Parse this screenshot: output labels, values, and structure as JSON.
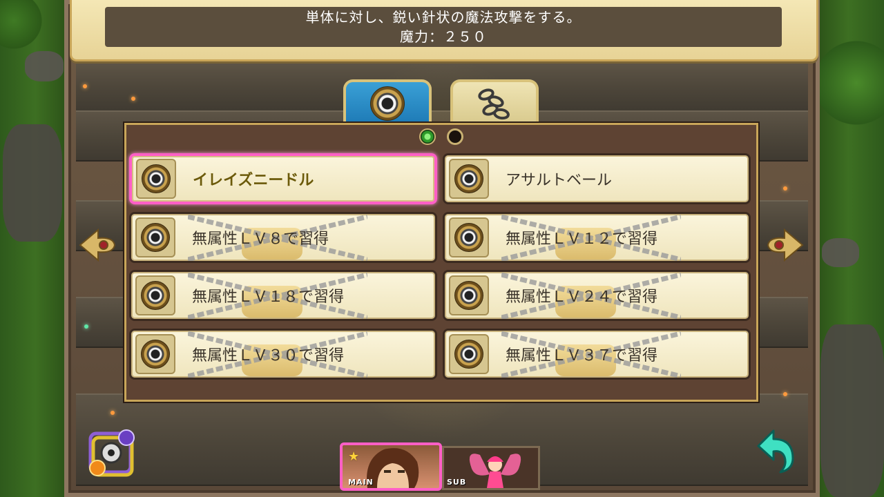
{
  "description": {
    "line1": "単体に対し、鋭い針状の魔法攻撃をする。",
    "line2": "魔力：２５０"
  },
  "tabs": [
    {
      "id": "magic",
      "icon": "eye-medal-icon",
      "selected": true
    },
    {
      "id": "chain",
      "icon": "chain-icon",
      "selected": false
    }
  ],
  "pagination": {
    "current": 1,
    "total": 2
  },
  "skills": [
    {
      "label": "イレイズニードル",
      "locked": false,
      "selected": true
    },
    {
      "label": "アサルトベール",
      "locked": false,
      "selected": false
    },
    {
      "label": "無属性ＬＶ８で習得",
      "locked": true,
      "selected": false
    },
    {
      "label": "無属性ＬＶ１２で習得",
      "locked": true,
      "selected": false
    },
    {
      "label": "無属性ＬＶ１８で習得",
      "locked": true,
      "selected": false
    },
    {
      "label": "無属性ＬＶ２４で習得",
      "locked": true,
      "selected": false
    },
    {
      "label": "無属性ＬＶ３０で習得",
      "locked": true,
      "selected": false
    },
    {
      "label": "無属性ＬＶ３７で習得",
      "locked": true,
      "selected": false
    }
  ],
  "characters": {
    "main_tag": "MAIN",
    "sub_tag": "SUB"
  },
  "icons": {
    "left_arrow": "ornate-left-arrow-icon",
    "right_arrow": "ornate-right-arrow-icon",
    "back": "back-arrow-icon",
    "swap": "element-swap-icon",
    "star": "star-icon"
  },
  "colors": {
    "selection": "#ff5fc6",
    "panel": "#5e4333",
    "gold_border": "#c9a659",
    "magic_tab": "#1d79b5"
  }
}
